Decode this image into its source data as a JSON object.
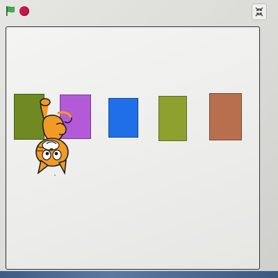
{
  "app": {
    "controls": {
      "green_flag_icon": "green-flag-icon",
      "stop_icon": "stop-icon",
      "fullscreen_icon": "exit-fullscreen-icon"
    }
  },
  "stage": {
    "blocks": [
      {
        "name": "block-olive-left",
        "color": "#6f8a22"
      },
      {
        "name": "block-purple",
        "color": "#b35ad9"
      },
      {
        "name": "block-blue",
        "color": "#1f6fe8"
      },
      {
        "name": "block-olive-right",
        "color": "#8ea12f"
      },
      {
        "name": "block-brown",
        "color": "#b86f4e"
      }
    ],
    "sprite": {
      "name": "scratch-cat",
      "orientation": "upside-down",
      "color": "#f29a26"
    }
  },
  "colors": {
    "flag_green": "#3bb54a",
    "stop_red": "#c8174a",
    "stage_border": "#2c2c2c"
  }
}
